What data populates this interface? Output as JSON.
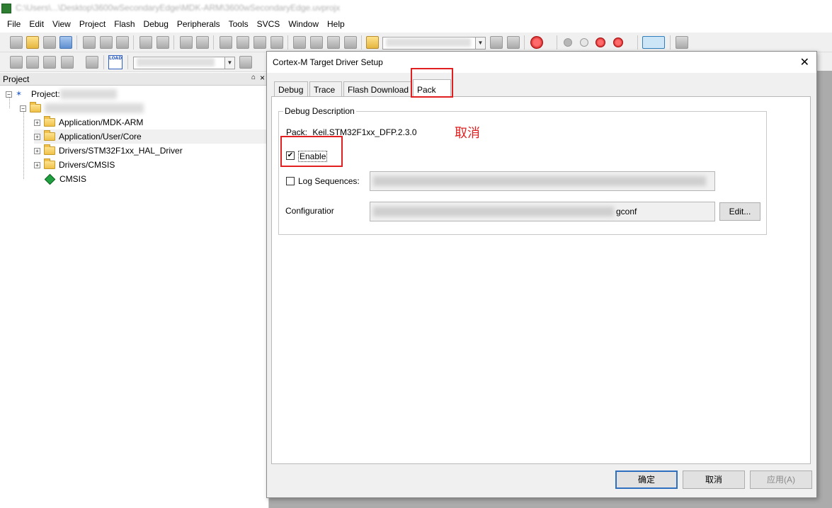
{
  "window": {
    "title": "C:\\Users\\...\\Desktop\\3600wSecondaryEdge\\MDK-ARM\\3600wSecondaryEdge.uvprojx"
  },
  "menu": [
    "File",
    "Edit",
    "View",
    "Project",
    "Flash",
    "Debug",
    "Peripherals",
    "Tools",
    "SVCS",
    "Window",
    "Help"
  ],
  "toolbar": {
    "load_label": "LOAD"
  },
  "project_panel": {
    "title": "Project",
    "pin_glyph": "⌂",
    "close_glyph": "×",
    "root_label": "Project: ",
    "items": [
      {
        "label": "Application/MDK-ARM",
        "icon": "folder-icon"
      },
      {
        "label": "Application/User/Core",
        "icon": "folder-icon"
      },
      {
        "label": "Drivers/STM32F1xx_HAL_Driver",
        "icon": "folder-icon"
      },
      {
        "label": "Drivers/CMSIS",
        "icon": "folder-icon"
      },
      {
        "label": "CMSIS",
        "icon": "diamond-icon"
      }
    ],
    "expander_plus": "+",
    "expander_minus": "−"
  },
  "dialog": {
    "title": "Cortex-M Target Driver Setup",
    "close_glyph": "✕",
    "tabs": [
      "Debug",
      "Trace",
      "Flash Download",
      "Pack"
    ],
    "active_tab": "Pack",
    "group_label": "Debug Description",
    "pack_label": "Pack:",
    "pack_value": "Keil.STM32F1xx_DFP.2.3.0",
    "enable_label": "Enable",
    "enable_checked": true,
    "check_glyph": "✔",
    "log_sequences_label": "Log Sequences:",
    "log_sequences_checked": false,
    "configuration_label": "Configuratior",
    "configuration_value_suffix": "gconf",
    "edit_button": "Edit...",
    "ok_button": "确定",
    "cancel_button": "取消",
    "apply_button": "应用(A)"
  },
  "annotation": {
    "text": "取消",
    "color": "#e02020"
  }
}
